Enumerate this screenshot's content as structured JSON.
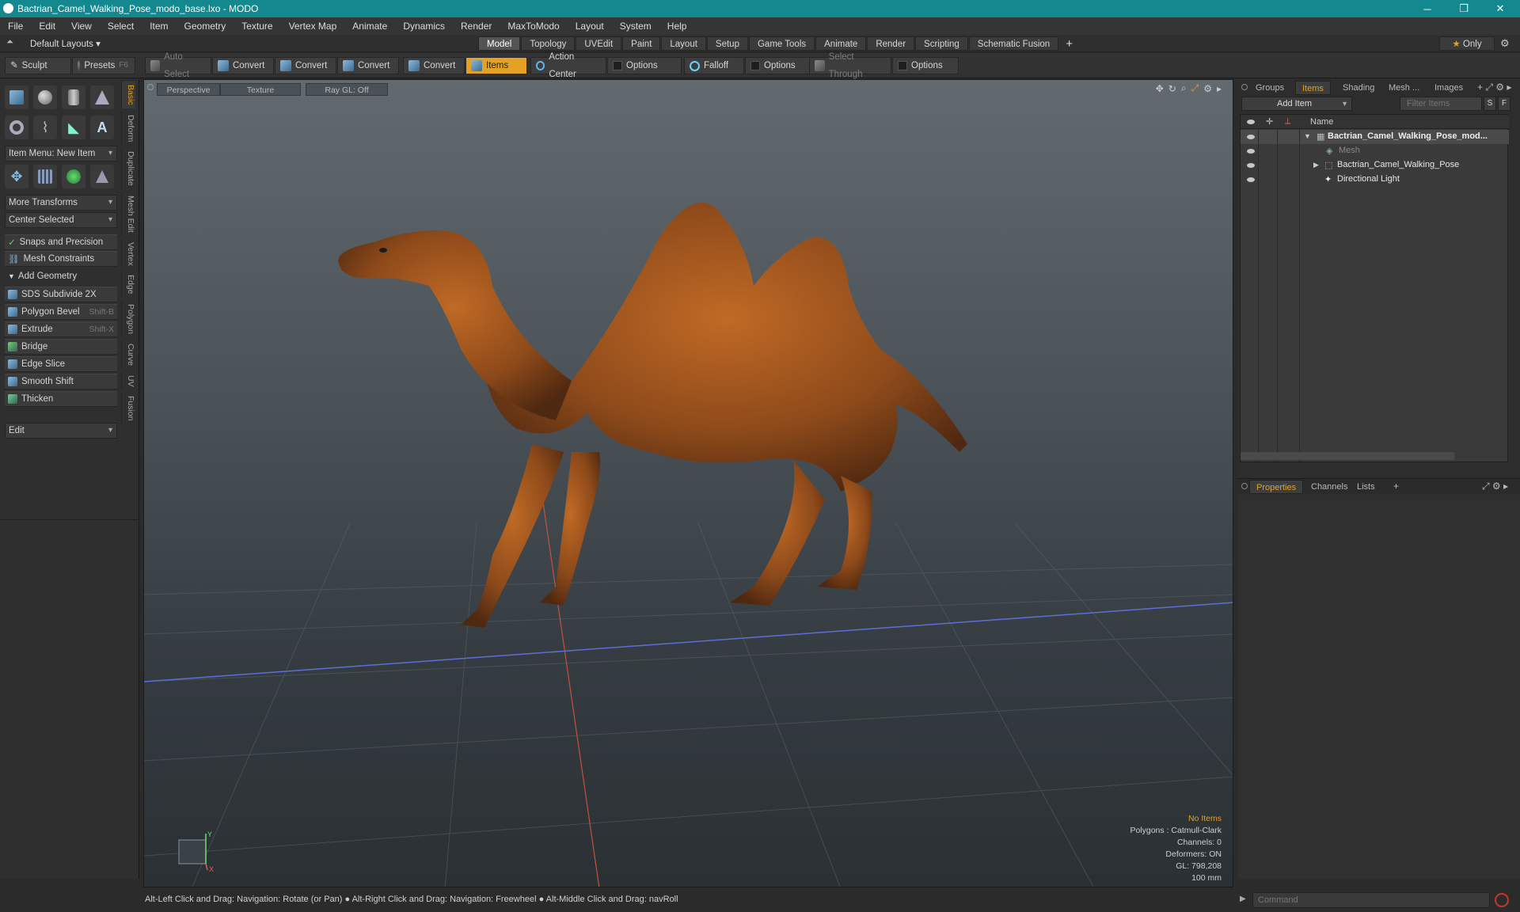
{
  "window": {
    "title": "Bactrian_Camel_Walking_Pose_modo_base.lxo - MODO",
    "minimize": "─",
    "maximize": "❐",
    "close": "✕"
  },
  "menu": [
    "File",
    "Edit",
    "View",
    "Select",
    "Item",
    "Geometry",
    "Texture",
    "Vertex Map",
    "Animate",
    "Dynamics",
    "Render",
    "MaxToModo",
    "Layout",
    "System",
    "Help"
  ],
  "layoutbar": {
    "layouts_label": "Default Layouts",
    "tabs": [
      "Model",
      "Topology",
      "UVEdit",
      "Paint",
      "Layout",
      "Setup",
      "Game Tools",
      "Animate",
      "Render",
      "Scripting",
      "Schematic Fusion"
    ],
    "active_tab": "Model",
    "add": "+",
    "only_label": "Only"
  },
  "toolbar": {
    "sculpt": "Sculpt",
    "presets": "Presets",
    "presets_shortcut": "F6",
    "auto_select": "Auto Select",
    "convert1": "Convert",
    "convert2": "Convert",
    "convert3": "Convert",
    "convert4": "Convert",
    "items": "Items",
    "action_center": "Action Center",
    "options1": "Options",
    "falloff": "Falloff",
    "options2": "Options",
    "select_through": "Select Through",
    "options3": "Options"
  },
  "leftpanel": {
    "item_menu": "Item Menu: New Item",
    "more_transforms": "More Transforms",
    "center_selected": "Center Selected",
    "snaps": "Snaps and Precision",
    "mesh_constraints": "Mesh Constraints",
    "add_geometry": "Add Geometry",
    "tools": [
      {
        "label": "SDS Subdivide 2X",
        "shortcut": ""
      },
      {
        "label": "Polygon Bevel",
        "shortcut": "Shift-B"
      },
      {
        "label": "Extrude",
        "shortcut": "Shift-X"
      },
      {
        "label": "Bridge",
        "shortcut": ""
      },
      {
        "label": "Edge Slice",
        "shortcut": ""
      },
      {
        "label": "Smooth Shift",
        "shortcut": ""
      },
      {
        "label": "Thicken",
        "shortcut": ""
      }
    ],
    "edit": "Edit",
    "vtabs": [
      "Basic",
      "Deform",
      "Duplicate",
      "Mesh Edit",
      "Vertex",
      "Edge",
      "Polygon",
      "Curve",
      "UV",
      "Fusion"
    ]
  },
  "viewport": {
    "view": "Perspective",
    "shading": "Texture",
    "raygl": "Ray GL: Off",
    "hud": {
      "no_items": "No Items",
      "polygons": "Polygons : Catmull-Clark",
      "channels": "Channels: 0",
      "deformers": "Deformers: ON",
      "gl": "GL: 798,208",
      "scale": "100 mm"
    },
    "axis_y": "Y",
    "axis_x": "X"
  },
  "rightpanel": {
    "tabs": [
      "Groups",
      "Items",
      "Shading",
      "Mesh ...",
      "Images"
    ],
    "active_tab": "Items",
    "add_item": "Add Item",
    "filter_placeholder": "Filter Items",
    "s_btn": "S",
    "f_btn": "F",
    "name_col": "Name",
    "tree": [
      {
        "label": "Bactrian_Camel_Walking_Pose_mod...",
        "indent": 0,
        "bold": true
      },
      {
        "label": "Mesh",
        "indent": 2,
        "dim": true
      },
      {
        "label": "Bactrian_Camel_Walking_Pose",
        "indent": 1
      },
      {
        "label": "Directional Light",
        "indent": 1
      }
    ],
    "prop_tabs": [
      "Properties",
      "Channels",
      "Lists"
    ],
    "prop_add": "+"
  },
  "status": {
    "text": "Alt-Left Click and Drag: Navigation: Rotate (or Pan) ● Alt-Right Click and Drag: Navigation: Freewheel ● Alt-Middle Click and Drag: navRoll",
    "command_placeholder": "Command"
  },
  "colors": {
    "accent": "#e3a125",
    "titlebar": "#13898f"
  }
}
